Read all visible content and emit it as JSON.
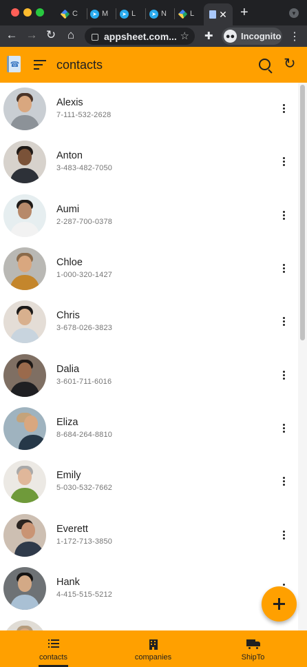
{
  "browser": {
    "tabs": [
      {
        "icon": "google-drive-icon",
        "label": "C"
      },
      {
        "icon": "telegram-icon",
        "label": "M"
      },
      {
        "icon": "telegram-icon",
        "label": "L"
      },
      {
        "icon": "telegram-icon",
        "label": "N"
      },
      {
        "icon": "google-drive-icon",
        "label": "L"
      }
    ],
    "active_tab_close": "✕",
    "new_tab": "+",
    "url": "appsheet.com...",
    "incognito_label": "Incognito"
  },
  "app": {
    "title": "contacts",
    "accent_color": "#ffa000"
  },
  "contacts": [
    {
      "name": "Alexis",
      "phone": "7-111-532-2628"
    },
    {
      "name": "Anton",
      "phone": "3-483-482-7050"
    },
    {
      "name": "Aumi",
      "phone": "2-287-700-0378"
    },
    {
      "name": "Chloe",
      "phone": "1-000-320-1427"
    },
    {
      "name": "Chris",
      "phone": "3-678-026-3823"
    },
    {
      "name": "Dalia",
      "phone": "3-601-711-6016"
    },
    {
      "name": "Eliza",
      "phone": "8-684-264-8810"
    },
    {
      "name": "Emily",
      "phone": "5-030-532-7662"
    },
    {
      "name": "Everett",
      "phone": "1-172-713-3850"
    },
    {
      "name": "Hank",
      "phone": "4-415-515-5212"
    }
  ],
  "bottom_nav": [
    {
      "label": "contacts",
      "icon": "list-icon",
      "active": true
    },
    {
      "label": "companies",
      "icon": "building-icon",
      "active": false
    },
    {
      "label": "ShipTo",
      "icon": "truck-icon",
      "active": false
    }
  ]
}
